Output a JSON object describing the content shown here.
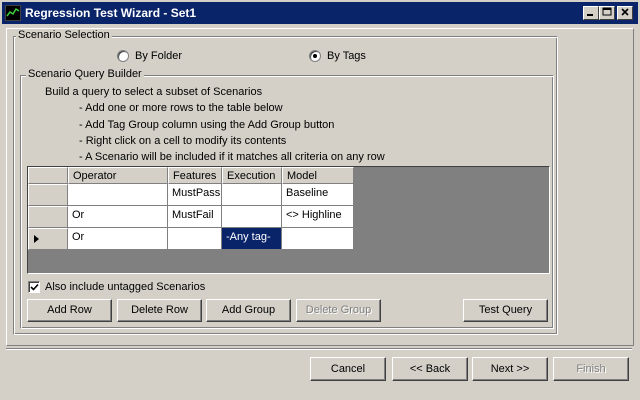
{
  "window": {
    "title": "Regression Test Wizard - Set1",
    "icon": "app-icon"
  },
  "scenario_selection": {
    "label": "Scenario Selection",
    "options": [
      {
        "label": "By Folder",
        "checked": false
      },
      {
        "label": "By Tags",
        "checked": true
      }
    ]
  },
  "query_builder": {
    "label": "Scenario Query Builder",
    "instructions": [
      "Build a query to select a subset of Scenarios",
      "- Add one or more rows to the table below",
      "- Add Tag Group column using the Add Group button",
      "- Right click on a cell to modify its contents",
      "- A Scenario will be included if it matches all criteria on any row"
    ],
    "columns": [
      "Operator",
      "Features",
      "Execution",
      "Model"
    ],
    "rows": [
      {
        "current": false,
        "cells": [
          "",
          "MustPass",
          "",
          "Baseline"
        ]
      },
      {
        "current": false,
        "cells": [
          "Or",
          "MustFail",
          "",
          "<> Highline"
        ]
      },
      {
        "current": true,
        "cells": [
          "Or",
          "",
          "-Any tag-",
          ""
        ]
      }
    ],
    "include_untagged": {
      "label": "Also include untagged Scenarios",
      "checked": true
    },
    "buttons": {
      "add_row": "Add Row",
      "delete_row": "Delete Row",
      "add_group": "Add Group",
      "delete_group": "Delete Group",
      "test_query": "Test Query"
    }
  },
  "nav": {
    "cancel": "Cancel",
    "back": "<< Back",
    "next": "Next >>",
    "finish": "Finish"
  },
  "colors": {
    "face": "#d4d0c8",
    "title_bar": "#0a246a",
    "selection": "#0a246a",
    "grid_background": "#808080"
  }
}
